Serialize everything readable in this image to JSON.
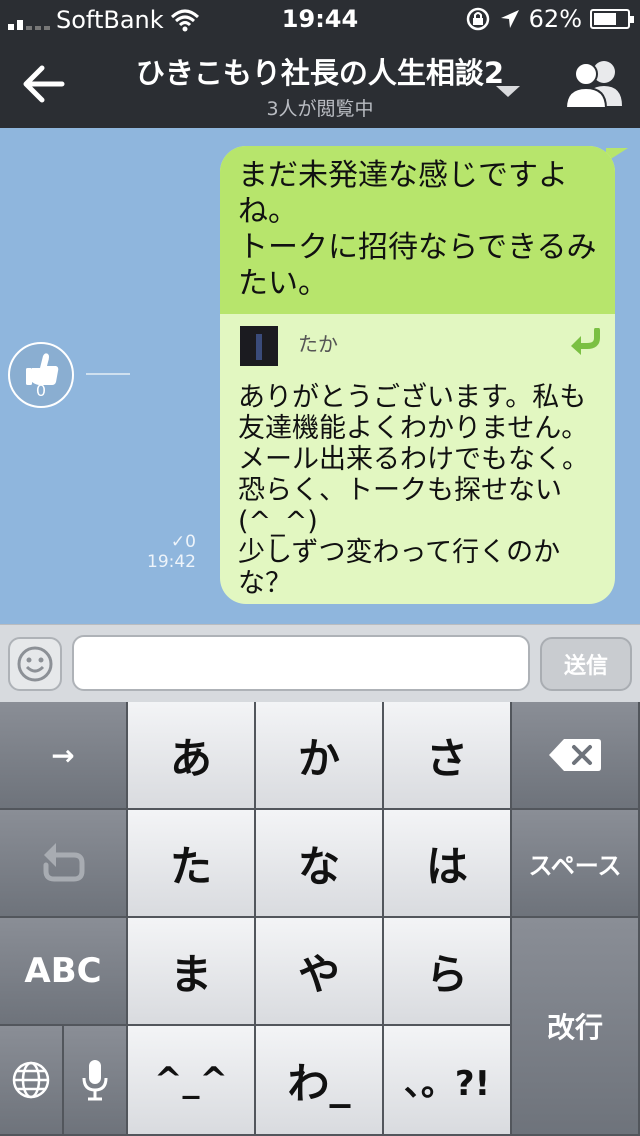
{
  "status_bar": {
    "carrier": "SoftBank",
    "time": "19:44",
    "battery": "62%"
  },
  "header": {
    "back_icon": "back-arrow-icon",
    "title": "ひきこもり社長の人生相談2",
    "subtitle": "3人が閲覧中",
    "members_icon": "members-icon"
  },
  "chat": {
    "like_count": "0",
    "read_count": "0",
    "time": "19:42",
    "message": {
      "text": "まだ未発達な感じですよね。\nトークに招待ならできるみたい。",
      "quote": {
        "author": "たか",
        "text": "ありがとうございます。私も友達機能よくわかりません。メール出来るわけでもなく。恐らく、トークも探せない(^_^)\n少しずつ変わって行くのかな？"
      }
    }
  },
  "input_bar": {
    "placeholder": "",
    "send_label": "送信"
  },
  "keyboard": {
    "keys": {
      "next": "→",
      "a": "あ",
      "ka": "か",
      "sa": "さ",
      "ta": "た",
      "na": "な",
      "ha": "は",
      "space": "スペース",
      "abc": "ABC",
      "ma": "ま",
      "ya": "や",
      "ra": "ら",
      "return": "改行",
      "face": "^_^",
      "wa": "わ_",
      "punct": "、。?!"
    }
  },
  "colors": {
    "header_bg": "#2b2e33",
    "chat_bg": "#8fb6dd",
    "bubble_green": "#b7e56c",
    "quote_green": "#e2f7c1",
    "reply_arrow": "#7bc043"
  }
}
